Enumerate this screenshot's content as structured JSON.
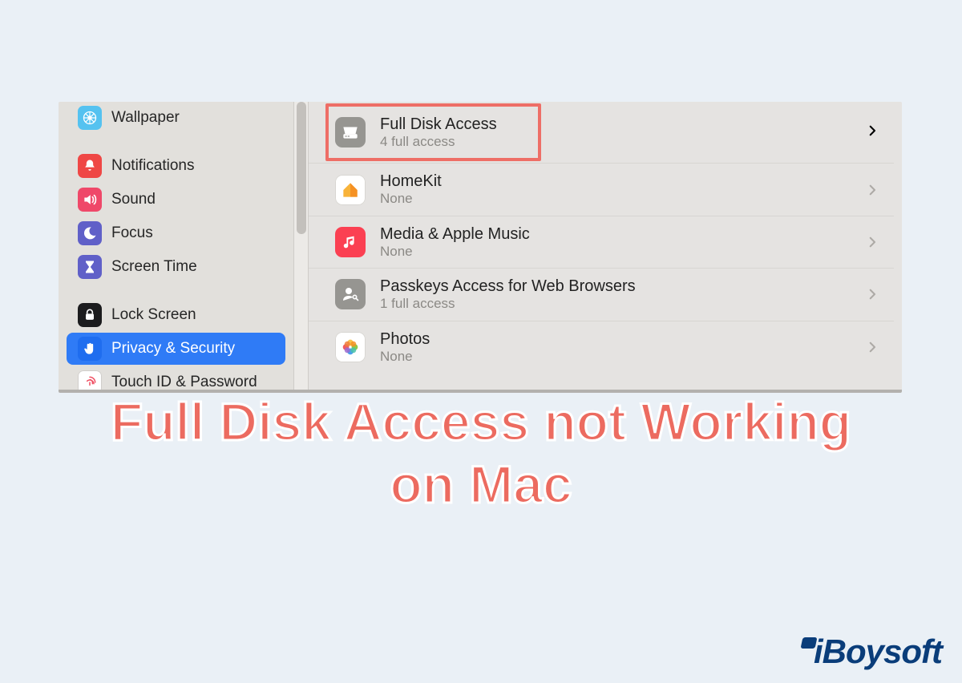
{
  "sidebar": {
    "items": [
      {
        "label": "Wallpaper"
      },
      {
        "label": "Notifications"
      },
      {
        "label": "Sound"
      },
      {
        "label": "Focus"
      },
      {
        "label": "Screen Time"
      },
      {
        "label": "Lock Screen"
      },
      {
        "label": "Privacy & Security"
      },
      {
        "label": "Touch ID & Password"
      }
    ]
  },
  "content": {
    "rows": [
      {
        "title": "Full Disk Access",
        "sub": "4 full access"
      },
      {
        "title": "HomeKit",
        "sub": "None"
      },
      {
        "title": "Media & Apple Music",
        "sub": "None"
      },
      {
        "title": "Passkeys Access for Web Browsers",
        "sub": "1 full access"
      },
      {
        "title": "Photos",
        "sub": "None"
      }
    ]
  },
  "caption_line1": "Full Disk Access not Working",
  "caption_line2": "on Mac",
  "brand": "iBoysoft"
}
